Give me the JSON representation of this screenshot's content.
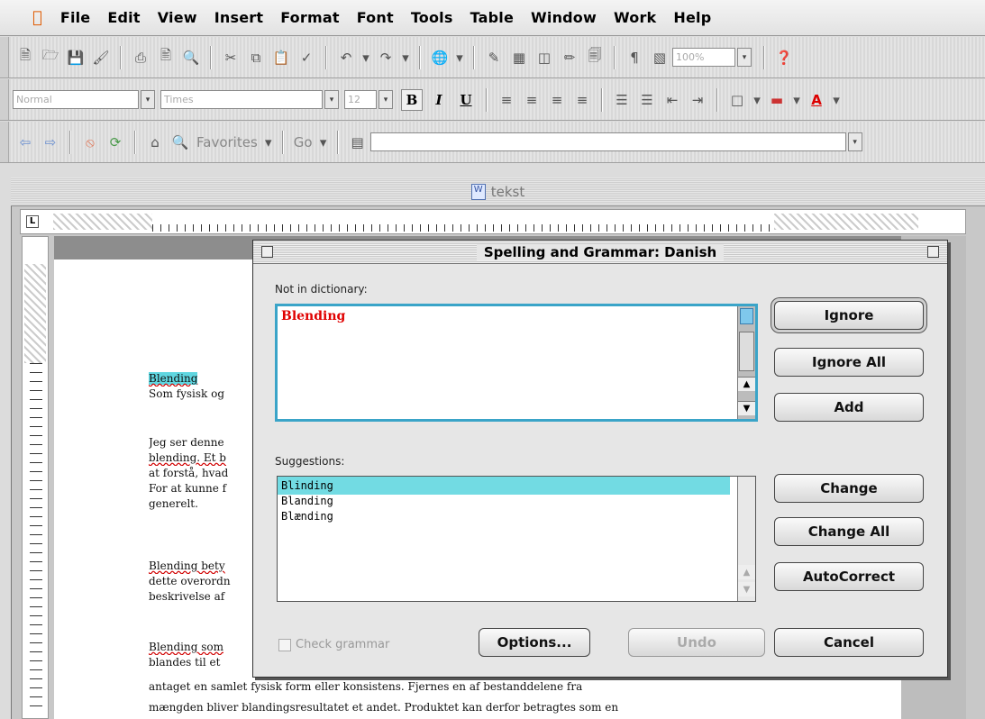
{
  "menubar": {
    "items": [
      "File",
      "Edit",
      "View",
      "Insert",
      "Format",
      "Font",
      "Tools",
      "Table",
      "Window",
      "Work",
      "Help"
    ]
  },
  "format_toolbar": {
    "style_value": "Normal",
    "font_value": "Times",
    "size_value": "12",
    "bold": "B",
    "italic": "I",
    "underline": "U"
  },
  "standard_toolbar": {
    "zoom_value": "100%"
  },
  "web_toolbar": {
    "favorites_label": "Favorites",
    "go_label": "Go",
    "address_value": ""
  },
  "document": {
    "title": "tekst",
    "lines": [
      {
        "text": "Blending",
        "style": "heading"
      },
      {
        "text": "Som fysisk og",
        "style": "normal"
      },
      {
        "text": "Jeg ser denne",
        "style": "normal"
      },
      {
        "text": "blending. Et b",
        "style": "normal"
      },
      {
        "text": "at forstå, hvad",
        "style": "normal"
      },
      {
        "text": "For at kunne f",
        "style": "normal"
      },
      {
        "text": "generelt.",
        "style": "normal"
      },
      {
        "text": "Blending bety",
        "style": "normal"
      },
      {
        "text": "dette overordn",
        "style": "normal"
      },
      {
        "text": "beskrivelse af",
        "style": "normal"
      },
      {
        "text": "Blending som",
        "style": "normal"
      },
      {
        "text": "blandes til et",
        "style": "normal"
      },
      {
        "text": "antaget en samlet fysisk form eller konsistens. Fjernes en af bestanddelene fra",
        "style": "normal"
      },
      {
        "text": "mængden bliver blandingsresultatet et andet. Produktet kan derfor betragtes som en",
        "style": "normal"
      }
    ]
  },
  "dialog": {
    "title": "Spelling and Grammar: Danish",
    "not_in_dictionary_label": "Not in dictionary:",
    "flagged_word": "Blending",
    "suggestions_label": "Suggestions:",
    "suggestions": [
      "Blinding",
      "Blanding",
      "Blænding"
    ],
    "selected_suggestion": "Blinding",
    "buttons": {
      "ignore": "Ignore",
      "ignore_all": "Ignore All",
      "add": "Add",
      "change": "Change",
      "change_all": "Change All",
      "autocorrect": "AutoCorrect",
      "options": "Options...",
      "undo": "Undo",
      "cancel": "Cancel"
    },
    "check_grammar_label": "Check grammar",
    "check_grammar_checked": false
  },
  "colors": {
    "highlight": "#5fd6e0",
    "selection": "#72dbe3",
    "flagged_text": "#e00000",
    "focus_ring": "#3aa4c8"
  }
}
